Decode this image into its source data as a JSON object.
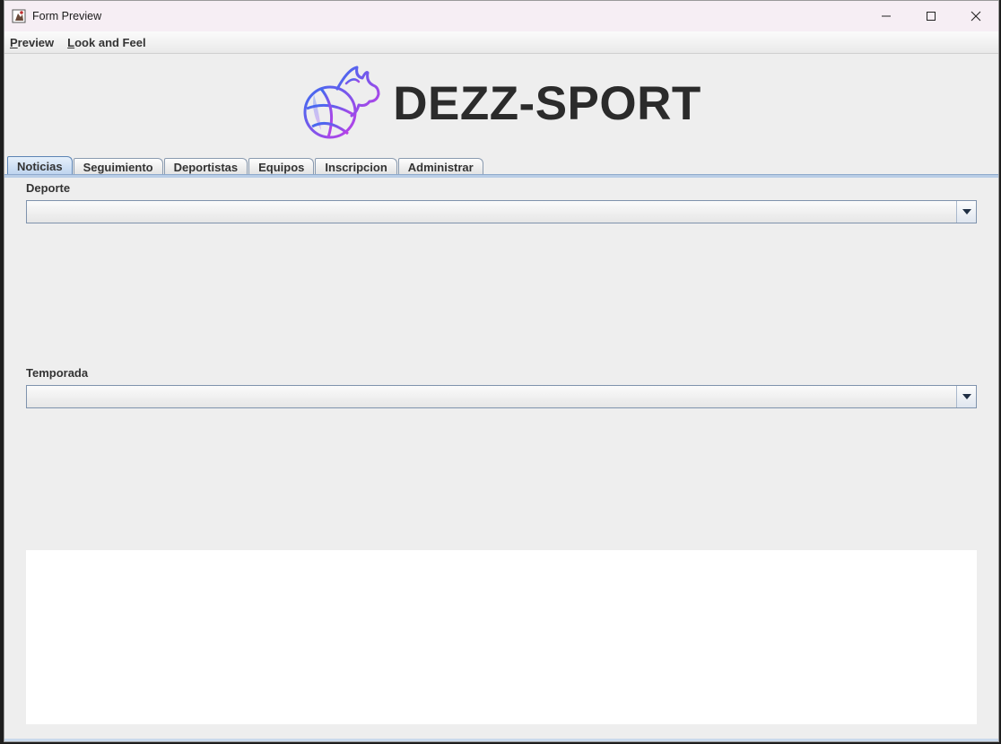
{
  "window": {
    "title": "Form Preview",
    "controls": {
      "minimize": "minimize-icon",
      "maximize": "maximize-icon",
      "close": "close-icon"
    }
  },
  "menubar": {
    "items": [
      {
        "mnemonic": "P",
        "rest": "review"
      },
      {
        "mnemonic": "L",
        "rest": "ook and Feel"
      }
    ]
  },
  "header": {
    "brand": "DEZZ-SPORT",
    "logo": "basketball-flame-icon",
    "logo_colors": [
      "#3a6df0",
      "#b14de8"
    ]
  },
  "tabs": [
    {
      "label": "Noticias",
      "selected": true
    },
    {
      "label": "Seguimiento",
      "selected": false
    },
    {
      "label": "Deportistas",
      "selected": false
    },
    {
      "label": "Equipos",
      "selected": false
    },
    {
      "label": "Inscripcion",
      "selected": false
    },
    {
      "label": "Administrar",
      "selected": false
    }
  ],
  "form": {
    "deporte": {
      "label": "Deporte",
      "value": ""
    },
    "temporada": {
      "label": "Temporada",
      "value": ""
    }
  },
  "colors": {
    "titlebar": "#f6eef4",
    "panel": "#eeeeee",
    "active_tab": "#bdd3ee",
    "text": "#333333"
  }
}
